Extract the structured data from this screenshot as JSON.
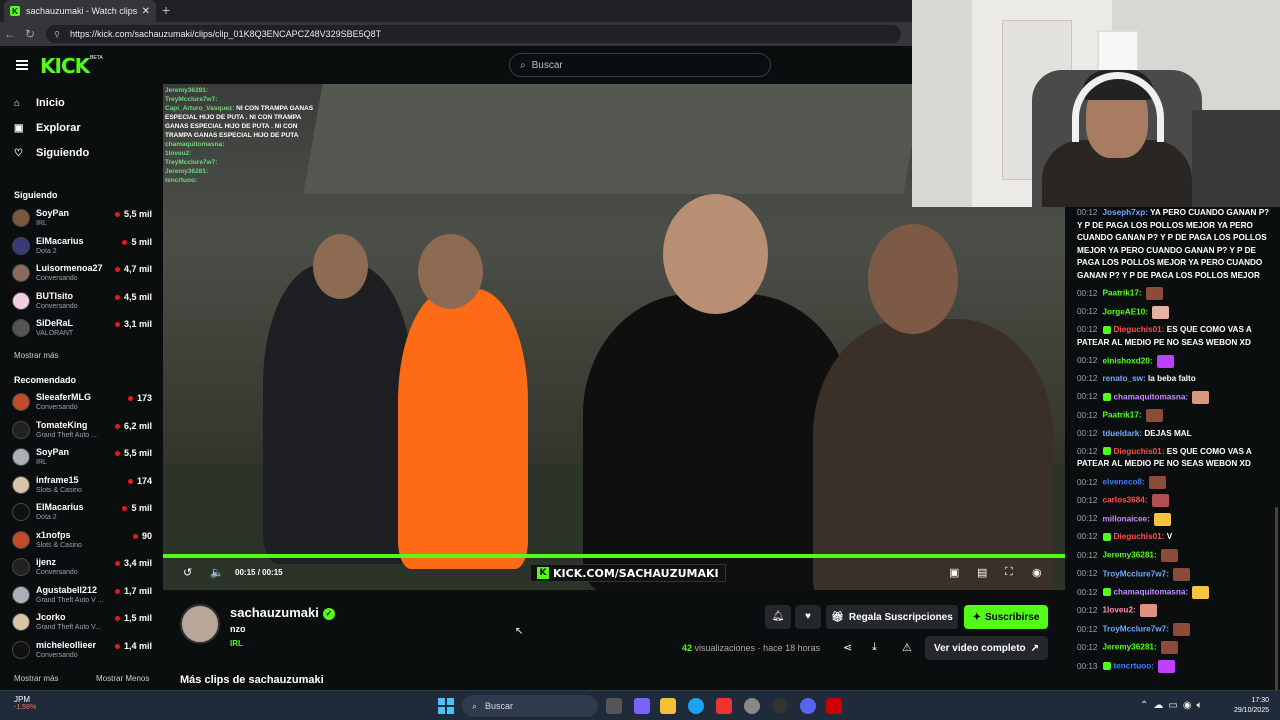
{
  "browser": {
    "tab_title": "sachauzumaki - Watch clips on Kick",
    "url": "https://kick.com/sachauzumaki/clips/clip_01K8Q3ENCAPCZ48V329SBE5Q8T"
  },
  "header": {
    "logo": "KICK",
    "logo_badge": "BETA",
    "search_placeholder": "Buscar"
  },
  "sidebar": {
    "nav": [
      {
        "label": "Inicio",
        "icon": "home-icon"
      },
      {
        "label": "Explorar",
        "icon": "explore-icon"
      },
      {
        "label": "Siguiendo",
        "icon": "heart-icon"
      }
    ],
    "following_title": "Siguiendo",
    "following": [
      {
        "name": "SoyPan",
        "category": "IRL",
        "viewers": "5,5 mil"
      },
      {
        "name": "ElMacarius",
        "category": "Dota 2",
        "viewers": "5 mil"
      },
      {
        "name": "Luisormenoa27",
        "category": "Conversando",
        "viewers": "4,7 mil"
      },
      {
        "name": "BUTIsito",
        "category": "Conversando",
        "viewers": "4,5 mil"
      },
      {
        "name": "SiDeRaL",
        "category": "VALORANT",
        "viewers": "3,1 mil"
      }
    ],
    "show_more": "Mostrar más",
    "recommended_title": "Recomendado",
    "recommended": [
      {
        "name": "SleeaferMLG",
        "category": "Conversando",
        "viewers": "173"
      },
      {
        "name": "TomateKing",
        "category": "Grand Theft Auto ...",
        "viewers": "6,2 mil"
      },
      {
        "name": "SoyPan",
        "category": "IRL",
        "viewers": "5,5 mil"
      },
      {
        "name": "inframe15",
        "category": "Slots & Casino",
        "viewers": "174"
      },
      {
        "name": "ElMacarius",
        "category": "Dota 2",
        "viewers": "5 mil"
      },
      {
        "name": "x1nofps",
        "category": "Slots & Casino",
        "viewers": "90"
      },
      {
        "name": "ijenz",
        "category": "Conversando",
        "viewers": "3,4 mil"
      },
      {
        "name": "Agustabell212",
        "category": "Grand Theft Auto V ...",
        "viewers": "1,7 mil"
      },
      {
        "name": "Jcorko",
        "category": "Grand Theft Auto V...",
        "viewers": "1,5 mil"
      },
      {
        "name": "micheleollieer",
        "category": "Conversando",
        "viewers": "1,4 mil"
      }
    ],
    "show_more2": "Mostrar más",
    "show_less": "Mostrar Menos"
  },
  "video": {
    "time_current": "00:15",
    "time_total": "00:15",
    "progress": 1.0,
    "watermark": "KICK.COM/SACHAUZUMAKI",
    "overlay_chat": [
      {
        "user": "Jeremy36281:",
        "text": ""
      },
      {
        "user": "TreyMcclure7w7:",
        "text": ""
      },
      {
        "user": "Capi_Arturo_Vasquez:",
        "text": "NI CON TRAMPA GANAS ESPECIAL HIJO DE PUTA . NI CON TRAMPA GANAS ESPECIAL HIJO DE PUTA . NI CON TRAMPA GANAS ESPECIAL HIJO DE PUTA"
      },
      {
        "user": "chamaquitomasna:",
        "text": ""
      },
      {
        "user": "1loveu2:",
        "text": ""
      },
      {
        "user": "TreyMcclure7w7:",
        "text": ""
      },
      {
        "user": "Jeremy36281:",
        "text": ""
      },
      {
        "user": "tencrtuoo:",
        "text": ""
      }
    ]
  },
  "clip_info": {
    "channel": "sachauzumaki",
    "title": "nzo",
    "category": "IRL",
    "gift_label": "Regala Suscripciones",
    "subscribe_label": "Suscribirse",
    "views_count": "42",
    "views_label": "visualizaciones",
    "time_ago": "· hace 18 horas",
    "full_video_label": "Ver video completo",
    "more_clips": "Más clips de sachauzumaki"
  },
  "chat": [
    {
      "time": "00:12",
      "user": "Joseph7xp:",
      "color": "#6ea8ff",
      "text": "YA PERO CUANDO GANAN P? Y P DE PAGA LOS POLLOS MEJOR YA PERO CUANDO GANAN P? Y P DE PAGA LOS POLLOS MEJOR YA PERO CUANDO GANAN P? Y P DE PAGA LOS POLLOS MEJOR YA PERO CUANDO GANAN P? Y P DE PAGA LOS POLLOS MEJOR",
      "badge": false,
      "emote": ""
    },
    {
      "time": "00:12",
      "user": "Paatrik17:",
      "color": "#53fc18",
      "text": "",
      "badge": false,
      "emote": "#8b4b3a"
    },
    {
      "time": "00:12",
      "user": "JorgeAE10:",
      "color": "#53fc18",
      "text": "",
      "badge": false,
      "emote": "#e8b0a0"
    },
    {
      "time": "00:12",
      "user": "Dieguchis01:",
      "color": "#ff4d4d",
      "text": "ES QUE COMO VAS A PATEAR AL MEDIO PE NO SEAS WEBON XD",
      "badge": true,
      "emote": ""
    },
    {
      "time": "00:12",
      "user": "elnishoxd20:",
      "color": "#53fc18",
      "text": "",
      "badge": false,
      "emote": "#c040ff"
    },
    {
      "time": "00:12",
      "user": "renato_sw:",
      "color": "#6ea8ff",
      "text": "la beba falto",
      "badge": false,
      "emote": ""
    },
    {
      "time": "00:12",
      "user": "chamaquitomasna:",
      "color": "#c58bff",
      "text": "",
      "badge": true,
      "emote": "#d79a80"
    },
    {
      "time": "00:12",
      "user": "Paatrik17:",
      "color": "#53fc18",
      "text": "",
      "badge": false,
      "emote": "#8b4b3a"
    },
    {
      "time": "00:12",
      "user": "tdueldark:",
      "color": "#6ea8ff",
      "text": "DEJAS MAL",
      "badge": false,
      "emote": ""
    },
    {
      "time": "00:12",
      "user": "Dieguchis01:",
      "color": "#ff4d4d",
      "text": "ES QUE COMO VAS A PATEAR AL MEDIO PE NO SEAS WEBON XD",
      "badge": true,
      "emote": ""
    },
    {
      "time": "00:12",
      "user": "elveneco8:",
      "color": "#3f7cff",
      "text": "",
      "badge": false,
      "emote": "#8b4b3a"
    },
    {
      "time": "00:12",
      "user": "carlos3684:",
      "color": "#ff4d4d",
      "text": "",
      "badge": false,
      "emote": "#b05050"
    },
    {
      "time": "00:12",
      "user": "millonaicee:",
      "color": "#c58bff",
      "text": "",
      "badge": false,
      "emote": "#f5c542"
    },
    {
      "time": "00:12",
      "user": "Dieguchis01:",
      "color": "#ff4d4d",
      "text": "V",
      "badge": true,
      "emote": ""
    },
    {
      "time": "00:12",
      "user": "Jeremy36281:",
      "color": "#53fc18",
      "text": "",
      "badge": false,
      "emote": "#8b4b3a"
    },
    {
      "time": "00:12",
      "user": "TroyMcclure7w7:",
      "color": "#6ea8ff",
      "text": "",
      "badge": false,
      "emote": "#8b4b3a"
    },
    {
      "time": "00:12",
      "user": "chamaquitomasna:",
      "color": "#c58bff",
      "text": "",
      "badge": true,
      "emote": "#f5c542"
    },
    {
      "time": "00:12",
      "user": "1loveu2:",
      "color": "#ff8fb1",
      "text": "",
      "badge": false,
      "emote": "#e09080"
    },
    {
      "time": "00:12",
      "user": "TroyMcclure7w7:",
      "color": "#6ea8ff",
      "text": "",
      "badge": false,
      "emote": "#8b4b3a"
    },
    {
      "time": "00:12",
      "user": "Jeremy36281:",
      "color": "#53fc18",
      "text": "",
      "badge": false,
      "emote": "#8b4b3a"
    },
    {
      "time": "00:13",
      "user": "tencrtuoo:",
      "color": "#3f7cff",
      "text": "",
      "badge": true,
      "emote": "#c040ff"
    }
  ],
  "taskbar": {
    "stock_name": "JPM",
    "stock_change": "-1.58%",
    "search_label": "Buscar",
    "time": "17:30",
    "date": "29/10/2025"
  }
}
